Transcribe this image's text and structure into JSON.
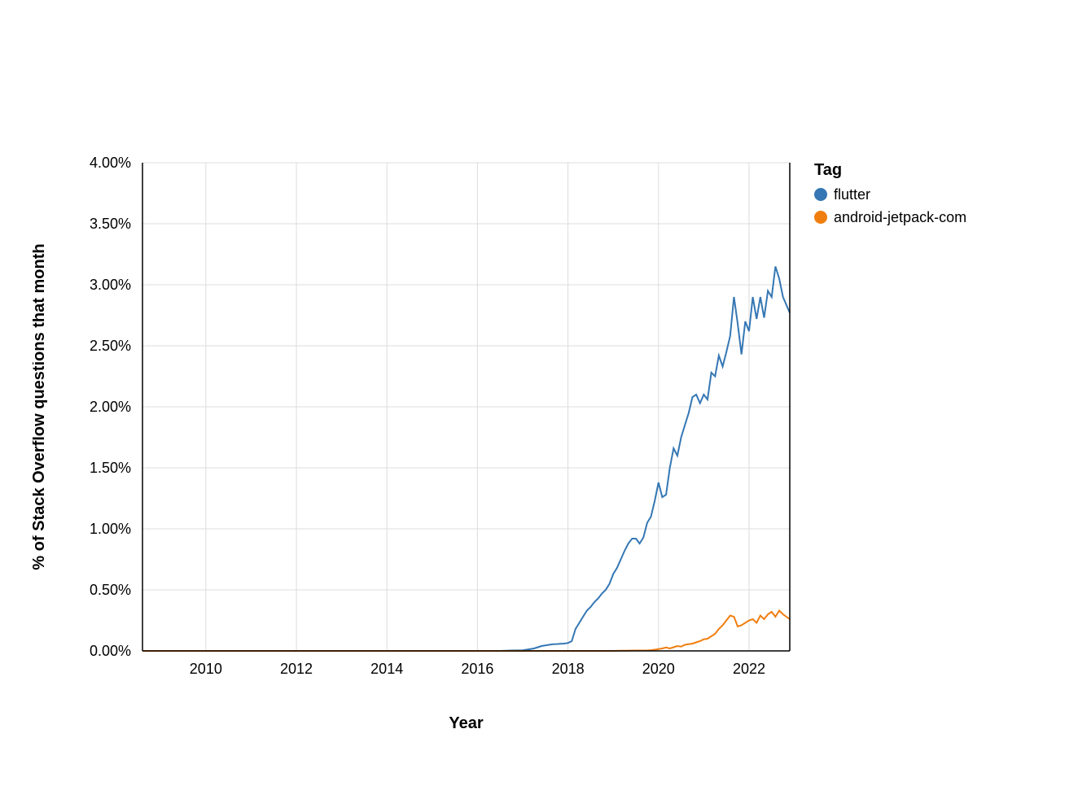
{
  "chart_data": {
    "type": "line",
    "xlabel": "Year",
    "ylabel": "% of Stack Overflow questions that month",
    "legend_title": "Tag",
    "x_ticks": [
      2010,
      2012,
      2014,
      2016,
      2018,
      2020,
      2022
    ],
    "y_ticks": [
      0.0,
      0.5,
      1.0,
      1.5,
      2.0,
      2.5,
      3.0,
      3.5,
      4.0
    ],
    "y_tick_labels": [
      "0.00%",
      "0.50%",
      "1.00%",
      "1.50%",
      "2.00%",
      "2.50%",
      "3.00%",
      "3.50%",
      "4.00%"
    ],
    "xlim": [
      2008.6,
      2022.9
    ],
    "ylim": [
      0.0,
      4.0
    ],
    "colors": {
      "flutter": "#3577b4",
      "android-jetpack-com": "#f07e0f"
    },
    "series": [
      {
        "name": "flutter",
        "x": [
          2008.6,
          2009.0,
          2010.0,
          2011.0,
          2012.0,
          2013.0,
          2014.0,
          2015.0,
          2015.5,
          2016.0,
          2016.5,
          2016.75,
          2017.0,
          2017.083,
          2017.167,
          2017.25,
          2017.333,
          2017.417,
          2017.5,
          2017.583,
          2017.667,
          2017.75,
          2017.833,
          2017.917,
          2018.0,
          2018.083,
          2018.167,
          2018.25,
          2018.333,
          2018.417,
          2018.5,
          2018.583,
          2018.667,
          2018.75,
          2018.833,
          2018.917,
          2019.0,
          2019.083,
          2019.167,
          2019.25,
          2019.333,
          2019.417,
          2019.5,
          2019.583,
          2019.667,
          2019.75,
          2019.833,
          2019.917,
          2020.0,
          2020.083,
          2020.167,
          2020.25,
          2020.333,
          2020.417,
          2020.5,
          2020.583,
          2020.667,
          2020.75,
          2020.833,
          2020.917,
          2021.0,
          2021.083,
          2021.167,
          2021.25,
          2021.333,
          2021.417,
          2021.5,
          2021.583,
          2021.667,
          2021.75,
          2021.833,
          2021.917,
          2022.0,
          2022.083,
          2022.167,
          2022.25,
          2022.333,
          2022.417,
          2022.5,
          2022.583,
          2022.667,
          2022.75,
          2022.9
        ],
        "values": [
          0.0,
          0.0,
          0.0,
          0.0,
          0.0,
          0.0,
          0.0,
          0.0,
          0.0,
          0.0,
          0.0,
          0.003,
          0.005,
          0.01,
          0.015,
          0.02,
          0.03,
          0.04,
          0.045,
          0.05,
          0.055,
          0.056,
          0.058,
          0.06,
          0.065,
          0.08,
          0.18,
          0.23,
          0.28,
          0.33,
          0.36,
          0.4,
          0.43,
          0.47,
          0.5,
          0.55,
          0.63,
          0.68,
          0.75,
          0.82,
          0.88,
          0.92,
          0.92,
          0.88,
          0.93,
          1.05,
          1.1,
          1.23,
          1.38,
          1.26,
          1.28,
          1.5,
          1.66,
          1.6,
          1.75,
          1.85,
          1.95,
          2.08,
          2.1,
          2.03,
          2.1,
          2.06,
          2.28,
          2.25,
          2.42,
          2.33,
          2.45,
          2.58,
          2.9,
          2.68,
          2.43,
          2.7,
          2.62,
          2.9,
          2.72,
          2.9,
          2.73,
          2.95,
          2.9,
          3.15,
          3.05,
          2.9,
          2.77
        ]
      },
      {
        "name": "android-jetpack-com",
        "x": [
          2008.6,
          2009.0,
          2010.0,
          2011.0,
          2012.0,
          2013.0,
          2014.0,
          2015.0,
          2016.0,
          2017.0,
          2018.0,
          2018.5,
          2019.0,
          2019.25,
          2019.5,
          2019.75,
          2019.833,
          2019.917,
          2020.0,
          2020.083,
          2020.167,
          2020.25,
          2020.333,
          2020.417,
          2020.5,
          2020.583,
          2020.667,
          2020.75,
          2020.833,
          2020.917,
          2021.0,
          2021.083,
          2021.167,
          2021.25,
          2021.333,
          2021.417,
          2021.5,
          2021.583,
          2021.667,
          2021.75,
          2021.833,
          2021.917,
          2022.0,
          2022.083,
          2022.167,
          2022.25,
          2022.333,
          2022.417,
          2022.5,
          2022.583,
          2022.667,
          2022.75,
          2022.9
        ],
        "values": [
          0.0,
          0.0,
          0.0,
          0.0,
          0.0,
          0.0,
          0.0,
          0.0,
          0.0,
          0.0,
          0.0,
          0.0,
          0.0,
          0.002,
          0.003,
          0.004,
          0.006,
          0.01,
          0.015,
          0.02,
          0.028,
          0.02,
          0.03,
          0.04,
          0.035,
          0.05,
          0.055,
          0.06,
          0.07,
          0.08,
          0.095,
          0.1,
          0.12,
          0.14,
          0.18,
          0.21,
          0.25,
          0.29,
          0.28,
          0.2,
          0.21,
          0.23,
          0.25,
          0.26,
          0.23,
          0.29,
          0.26,
          0.3,
          0.32,
          0.28,
          0.33,
          0.3,
          0.26
        ]
      }
    ]
  }
}
